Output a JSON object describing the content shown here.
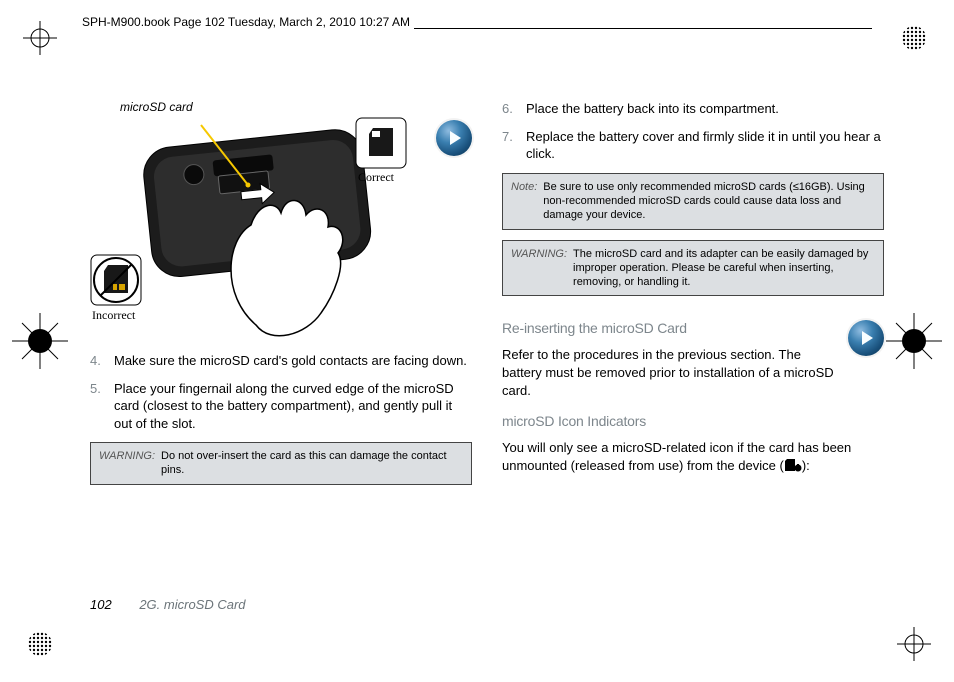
{
  "header": {
    "stamp": "SPH-M900.book  Page 102  Tuesday, March 2, 2010  10:27 AM"
  },
  "left": {
    "illustration": {
      "label_top": "microSD card",
      "correct_label": "Correct",
      "incorrect_label": "Incorrect"
    },
    "step4": {
      "num": "4.",
      "text": "Make sure the microSD card's gold contacts are facing down."
    },
    "step5": {
      "num": "5.",
      "text": "Place your fingernail along the curved edge of the microSD card (closest to the battery compartment), and gently pull it out of the slot."
    },
    "warning1": {
      "label": "WARNING:",
      "text": "Do not over-insert the card as this can damage the contact pins."
    }
  },
  "right": {
    "step6": {
      "num": "6.",
      "text": "Place the battery back into its compartment."
    },
    "step7": {
      "num": "7.",
      "text": "Replace the battery cover and firmly slide it in until you hear a click."
    },
    "note": {
      "label": "Note:",
      "text": "Be sure to use only recommended microSD cards (≤16GB). Using non-recommended microSD cards could cause data loss and damage your device."
    },
    "warning2": {
      "label": "WARNING:",
      "text": "The microSD card and its adapter can be easily damaged by improper operation. Please be careful when inserting, removing, or handling it."
    },
    "reinsert_heading": "Re-inserting the microSD Card",
    "reinsert_body": "Refer to the procedures in the previous section. The battery must be removed prior to installation of a microSD card.",
    "indicators_heading": "microSD Icon Indicators",
    "indicators_body_pre": "You will only see a microSD-related icon if the card has been unmounted (released from use) from the device (",
    "indicators_body_post": "):"
  },
  "footer": {
    "page_number": "102",
    "section": "2G. microSD Card"
  }
}
